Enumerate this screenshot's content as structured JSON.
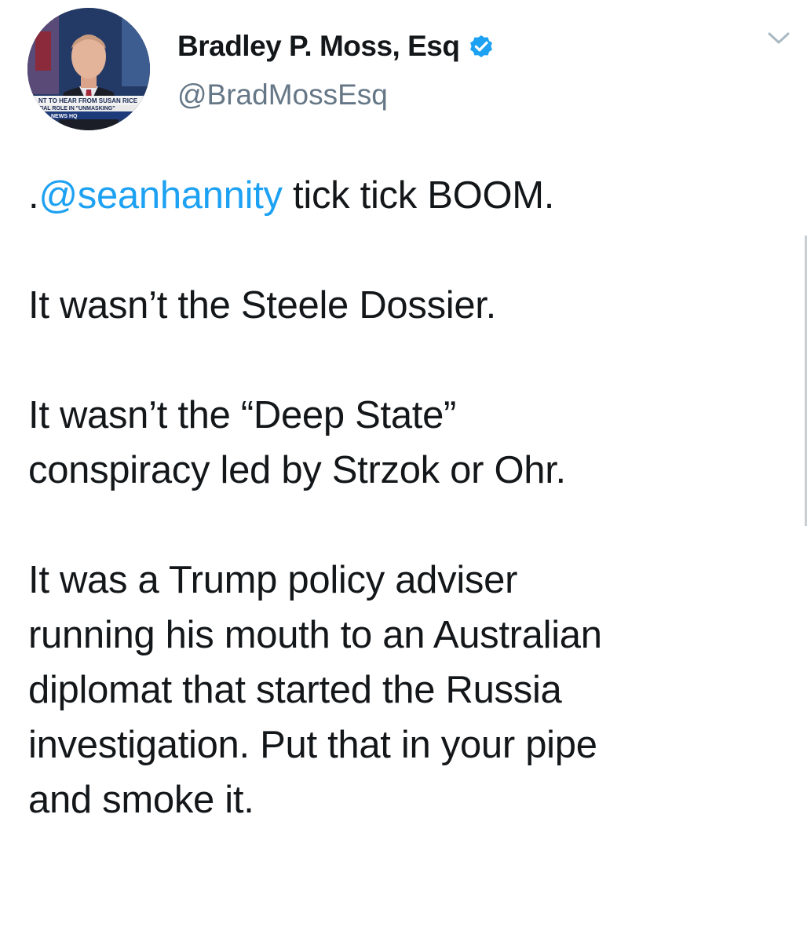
{
  "author": {
    "display_name": "Bradley P. Moss, Esq",
    "handle": "@BradMossEsq",
    "avatar_icon": "profile-photo",
    "avatar_caption_lines": [
      "NT TO HEAR FROM SUSAN RICE",
      "TIAL ROLE IN \"UNMASKING\"",
      "NEWS HQ"
    ],
    "verified_icon": "verified-badge-icon"
  },
  "menu": {
    "caret_icon": "chevron-down-icon"
  },
  "tweet": {
    "line1_prefix": ".",
    "mention": "@seanhannity",
    "line1_suffix": " tick tick BOOM.",
    "para2": "It wasn’t the Steele Dossier.",
    "para3_line1": "It wasn’t the “Deep State”",
    "para3_line2": "conspiracy led by Strzok or Ohr.",
    "para4_line1": "It was a Trump policy adviser",
    "para4_line2": "running his mouth to an Australian",
    "para4_line3": "diplomat that started the Russia",
    "para4_line4": "investigation. Put that in your pipe",
    "para4_line5": "and smoke it."
  },
  "colors": {
    "link": "#1da1f2",
    "text": "#14171a",
    "secondary": "#657786",
    "verified": "#1da1f2"
  }
}
